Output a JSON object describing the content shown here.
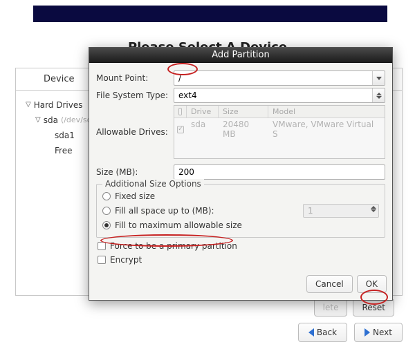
{
  "page": {
    "title": "Please Select A Device",
    "device_header": "Device",
    "tree": {
      "hard_drives": "Hard Drives",
      "sda": "sda",
      "sda_dev": "(/dev/sda)",
      "sda1": "sda1",
      "free": "Free"
    },
    "bottom": {
      "lete": "lete",
      "reset": "Reset"
    },
    "footer": {
      "back": "Back",
      "next": "Next"
    }
  },
  "modal": {
    "title": "Add Partition",
    "labels": {
      "mount_point": "Mount Point:",
      "fs_type": "File System Type:",
      "allowable_drives": "Allowable Drives:",
      "size": "Size (MB):"
    },
    "values": {
      "mount_point": "/",
      "fs_type": "ext4",
      "size": "200",
      "fill_upto": "1"
    },
    "drives": {
      "head": {
        "drive": "Drive",
        "size": "Size",
        "model": "Model"
      },
      "row": {
        "drive": "sda",
        "size": "20480 MB",
        "model": "VMware, VMware Virtual S"
      }
    },
    "group": {
      "title": "Additional Size Options",
      "fixed": "Fixed size",
      "fill_upto": "Fill all space up to (MB):",
      "fill_max": "Fill to maximum allowable size"
    },
    "checks": {
      "primary": "Force to be a primary partition",
      "encrypt": "Encrypt"
    },
    "buttons": {
      "cancel": "Cancel",
      "ok": "OK"
    }
  }
}
